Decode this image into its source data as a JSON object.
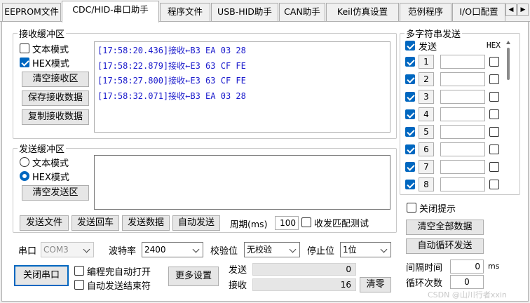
{
  "tabs": [
    {
      "label": "EEPROM文件"
    },
    {
      "label": "CDC/HID-串口助手"
    },
    {
      "label": "程序文件"
    },
    {
      "label": "USB-HID助手"
    },
    {
      "label": "CAN助手"
    },
    {
      "label": "Keil仿真设置"
    },
    {
      "label": "范例程序"
    },
    {
      "label": "I/O口配置"
    }
  ],
  "tab_scroll": {
    "left": "◀",
    "right": "▶"
  },
  "receive": {
    "title": "接收缓冲区",
    "text_mode": "文本模式",
    "hex_mode": "HEX模式",
    "text_mode_checked": false,
    "hex_mode_checked": true,
    "clear_btn": "清空接收区",
    "save_btn": "保存接收数据",
    "copy_btn": "复制接收数据",
    "lines": [
      "[17:58:20.436]接收←B3 EA 03 28",
      "[17:58:22.879]接收←E3 63 CF FE",
      "[17:58:27.800]接收←E3 63 CF FE",
      "[17:58:32.071]接收←B3 EA 03 28"
    ]
  },
  "send": {
    "title": "发送缓冲区",
    "text_mode": "文本模式",
    "hex_mode": "HEX模式",
    "selected": "hex",
    "clear_btn": "清空发送区",
    "send_file": "发送文件",
    "send_cr": "发送回车",
    "send_data": "发送数据",
    "auto_send": "自动发送",
    "period_label": "周期(ms)",
    "period_value": "100",
    "match_test": "收发匹配测试"
  },
  "port": {
    "port_label": "串口",
    "port_value": "COM3",
    "baud_label": "波特率",
    "baud_value": "2400",
    "parity_label": "校验位",
    "parity_value": "无校验",
    "stop_label": "停止位",
    "stop_value": "1位",
    "close_btn": "关闭串口",
    "auto_open": "编程完自动打开",
    "auto_send_end": "自动发送结束符",
    "more_settings": "更多设置",
    "sent_label": "发送",
    "sent_value": "0",
    "recv_label": "接收",
    "recv_value": "16",
    "clear_btn": "清零"
  },
  "multi": {
    "title": "多字符串发送",
    "send_label": "发送",
    "hex_label": "HEX",
    "rows": [
      {
        "num": "1",
        "checked": true
      },
      {
        "num": "2",
        "checked": true
      },
      {
        "num": "3",
        "checked": true
      },
      {
        "num": "4",
        "checked": true
      },
      {
        "num": "5",
        "checked": true
      },
      {
        "num": "6",
        "checked": true
      },
      {
        "num": "7",
        "checked": true
      },
      {
        "num": "8",
        "checked": true
      }
    ],
    "close_hint": "关闭提示",
    "clear_all": "清空全部数据",
    "auto_loop": "自动循环发送",
    "interval_label": "间隔时间",
    "interval_value": "0",
    "interval_unit": "ms",
    "loop_label": "循环次数",
    "loop_value": "0"
  },
  "watermark": "CSDN @山川行者xxin"
}
